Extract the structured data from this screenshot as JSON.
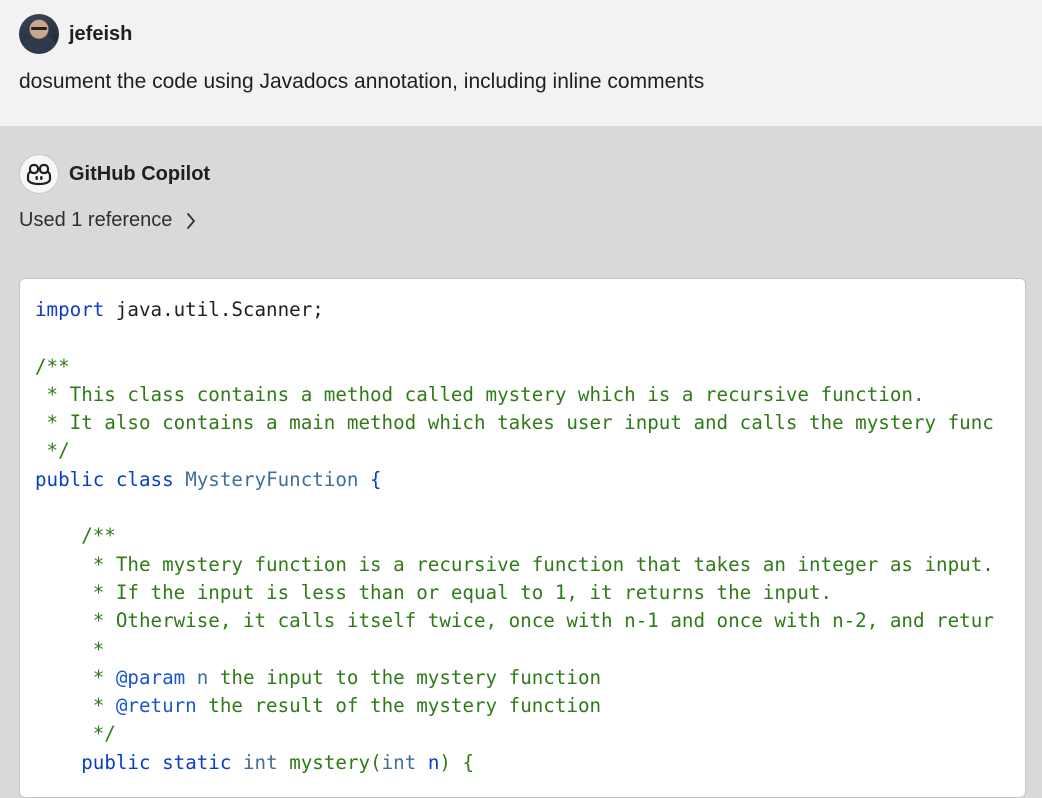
{
  "user": {
    "name": "jefeish",
    "prompt": "dosument the code using Javadocs annotation, including inline comments"
  },
  "assistant": {
    "name": "GitHub Copilot",
    "references_label": "Used 1 reference"
  },
  "icons": {
    "user_avatar": "user-avatar-photo",
    "copilot_avatar": "copilot-icon",
    "references_toggle": "chevron-right-icon"
  },
  "colors": {
    "keyword": "#0b3ec5",
    "class_name": "#3e6f9a",
    "comment": "#2f7a19",
    "javadoc_tag": "#1a56c9"
  },
  "code": {
    "language": "java",
    "lines": [
      [
        {
          "t": "kw",
          "v": "import"
        },
        {
          "t": "pn",
          "v": " java.util.Scanner;"
        }
      ],
      [],
      [
        {
          "t": "cm",
          "v": "/**"
        }
      ],
      [
        {
          "t": "cm",
          "v": " * This class contains a method called mystery which is a recursive function."
        }
      ],
      [
        {
          "t": "cm",
          "v": " * It also contains a main method which takes user input and calls the mystery func"
        }
      ],
      [
        {
          "t": "cm",
          "v": " */"
        }
      ],
      [
        {
          "t": "kw",
          "v": "public"
        },
        {
          "t": "pn",
          "v": " "
        },
        {
          "t": "kw",
          "v": "class"
        },
        {
          "t": "pn",
          "v": " "
        },
        {
          "t": "cls",
          "v": "MysteryFunction"
        },
        {
          "t": "pn",
          "v": " "
        },
        {
          "t": "kw",
          "v": "{"
        }
      ],
      [],
      [
        {
          "t": "cm",
          "v": "    /**"
        }
      ],
      [
        {
          "t": "cm",
          "v": "     * The mystery function is a recursive function that takes an integer as input."
        }
      ],
      [
        {
          "t": "cm",
          "v": "     * If the input is less than or equal to 1, it returns the input."
        }
      ],
      [
        {
          "t": "cm",
          "v": "     * Otherwise, it calls itself twice, once with n-1 and once with n-2, and retur"
        }
      ],
      [
        {
          "t": "cm",
          "v": "     *"
        }
      ],
      [
        {
          "t": "cm",
          "v": "     * "
        },
        {
          "t": "tag",
          "v": "@param"
        },
        {
          "t": "pn",
          "v": " "
        },
        {
          "t": "cls",
          "v": "n"
        },
        {
          "t": "cm",
          "v": " the input to the mystery function"
        }
      ],
      [
        {
          "t": "cm",
          "v": "     * "
        },
        {
          "t": "tag",
          "v": "@return"
        },
        {
          "t": "cm",
          "v": " the result of the mystery function"
        }
      ],
      [
        {
          "t": "cm",
          "v": "     */"
        }
      ],
      [
        {
          "t": "pn",
          "v": "    "
        },
        {
          "t": "kw",
          "v": "public"
        },
        {
          "t": "pn",
          "v": " "
        },
        {
          "t": "kw",
          "v": "static"
        },
        {
          "t": "pn",
          "v": " "
        },
        {
          "t": "cls",
          "v": "int"
        },
        {
          "t": "pn",
          "v": " "
        },
        {
          "t": "cm",
          "v": "mystery"
        },
        {
          "t": "cm",
          "v": "("
        },
        {
          "t": "cls",
          "v": "int"
        },
        {
          "t": "pn",
          "v": " "
        },
        {
          "t": "kw",
          "v": "n"
        },
        {
          "t": "cm",
          "v": ") {"
        }
      ]
    ]
  }
}
